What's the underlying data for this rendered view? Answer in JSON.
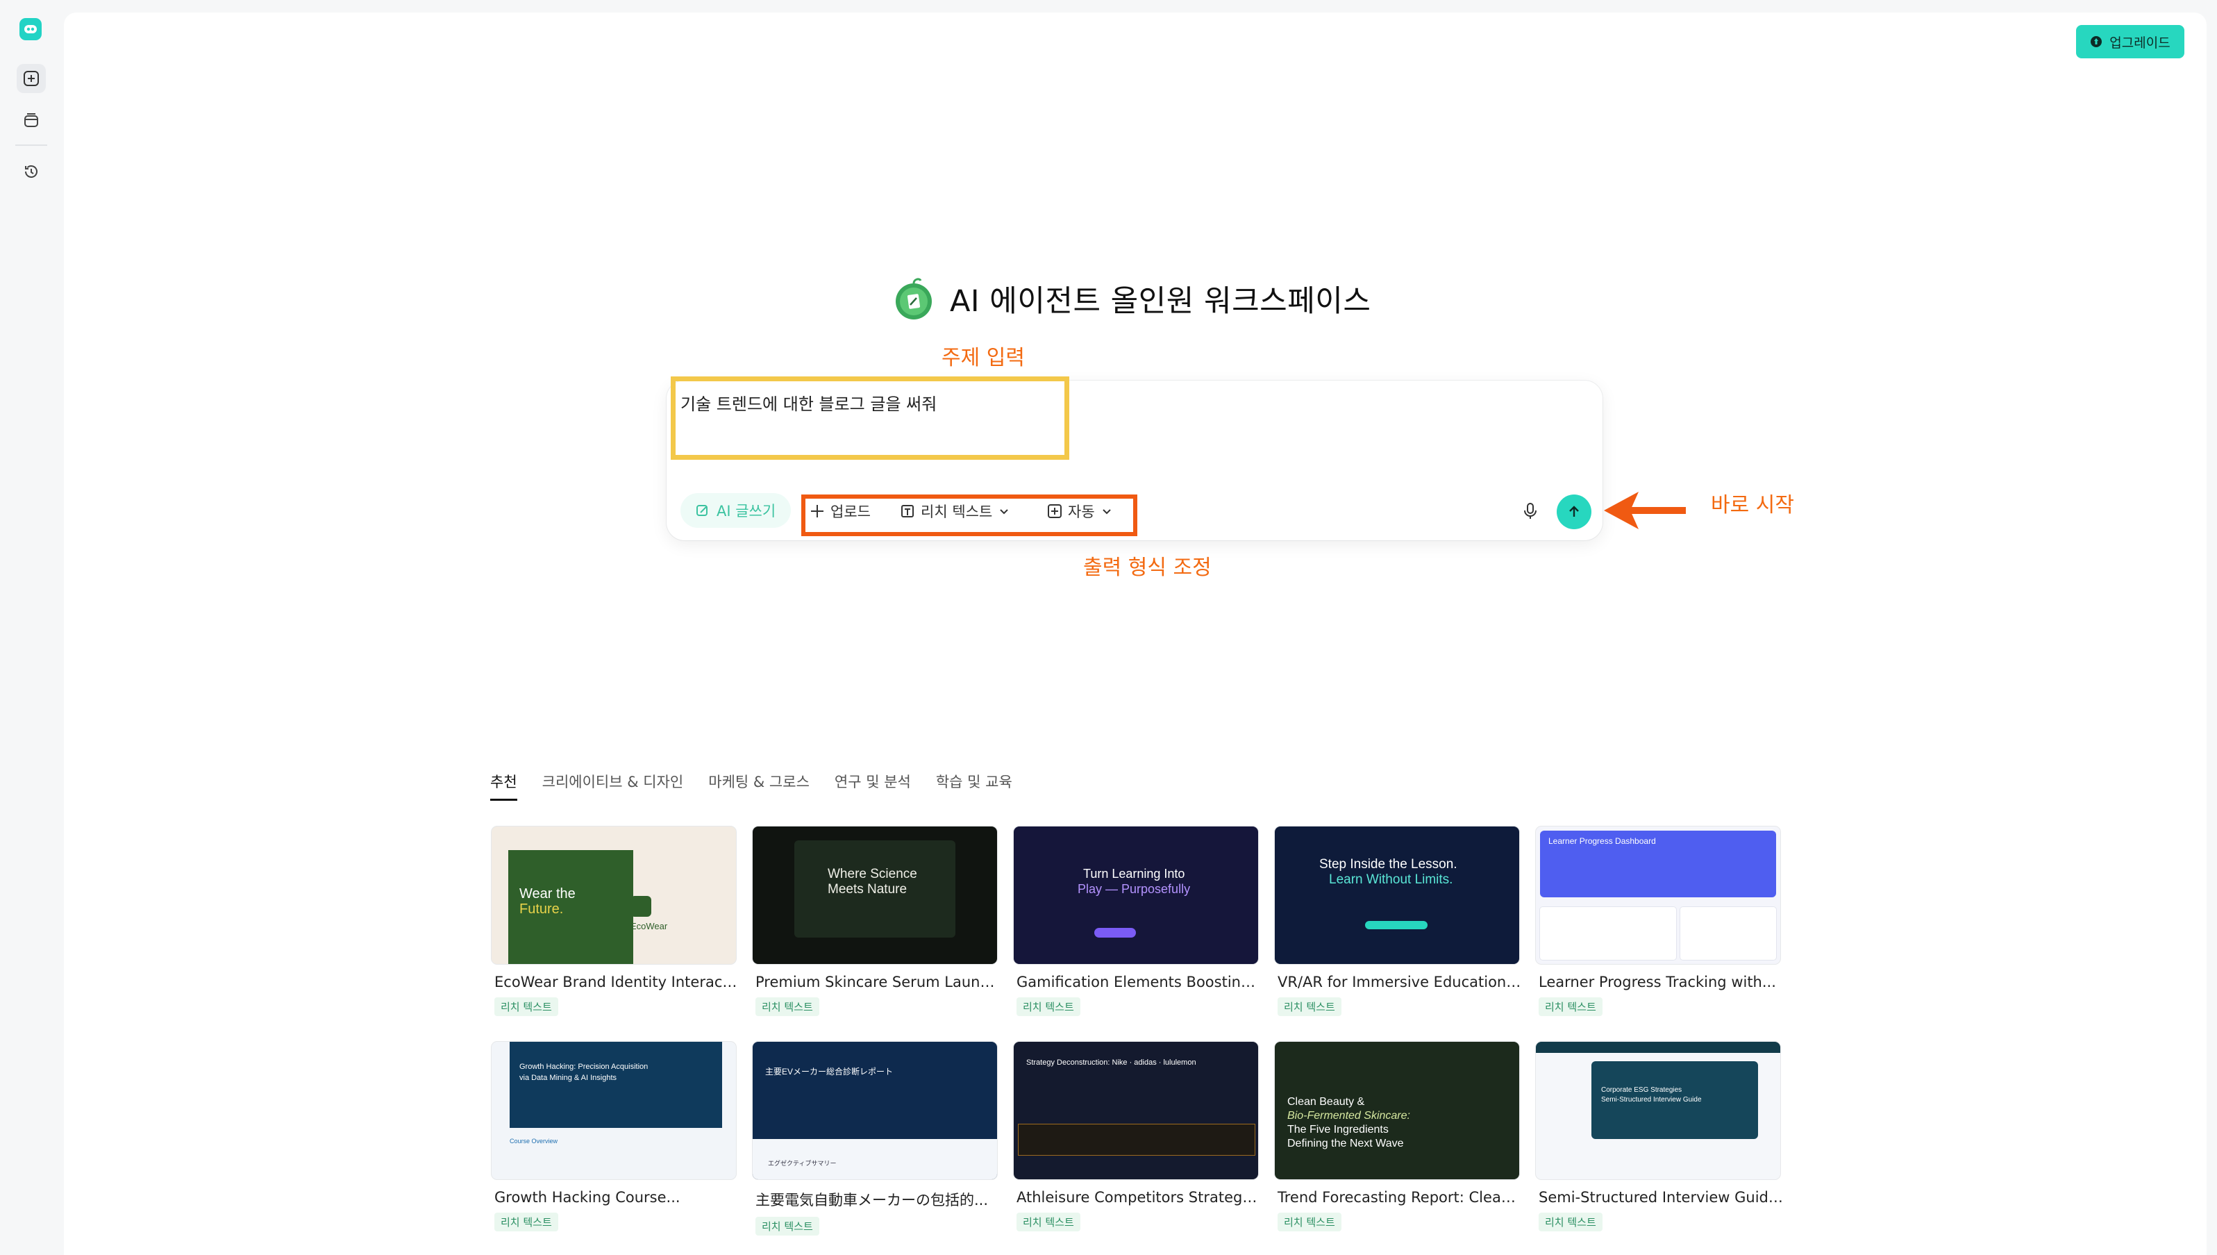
{
  "app": {
    "upgrade_label": "업그레이드",
    "accent_color": "#27d7bf"
  },
  "sidebar": {
    "items": [
      {
        "icon": "new-chat-icon"
      },
      {
        "icon": "library-icon"
      },
      {
        "icon": "history-icon"
      }
    ]
  },
  "hero": {
    "title": "AI 에이전트 올인원 워크스페이스"
  },
  "annotations": {
    "topic": "주제 입력",
    "format": "출력 형식 조정",
    "start": "바로 시작"
  },
  "composer": {
    "input_value": "기술 트렌드에 대한 블로그 글을 써줘",
    "ai_writing": "AI 글쓰기",
    "upload": "업로드",
    "rich_text": "리치 텍스트",
    "auto": "자동"
  },
  "tabs": [
    {
      "label": "추천",
      "active": true
    },
    {
      "label": "크리에이티브 & 디자인",
      "active": false
    },
    {
      "label": "마케팅 & 그로스",
      "active": false
    },
    {
      "label": "연구 및 분석",
      "active": false
    },
    {
      "label": "학습 및 교육",
      "active": false
    }
  ],
  "cards": [
    {
      "title": "EcoWear Brand Identity Interactiv...",
      "tag": "리치 텍스트",
      "thumb_text": [
        "Wear the",
        "Future.",
        "EcoWear"
      ]
    },
    {
      "title": "Premium Skincare Serum Launch...",
      "tag": "리치 텍스트",
      "thumb_text": [
        "Where Science",
        "Meets Nature"
      ]
    },
    {
      "title": "Gamification Elements Boosting...",
      "tag": "리치 텍스트",
      "thumb_text": [
        "Turn Learning Into",
        "Play — Purposefully"
      ]
    },
    {
      "title": "VR/AR for Immersive Educational...",
      "tag": "리치 텍스트",
      "thumb_text": [
        "Step Inside the Lesson.",
        "Learn Without Limits."
      ]
    },
    {
      "title": "Learner Progress Tracking with...",
      "tag": "리치 텍스트",
      "thumb_text": [
        "Learner Progress Dashboard"
      ]
    },
    {
      "title": "Growth Hacking Course...",
      "tag": "리치 텍스트",
      "thumb_text": [
        "Growth Hacking: Precision Acquisition",
        "via Data Mining & AI Insights",
        "Course Overview"
      ]
    },
    {
      "title": "主要電気自動車メーカーの包括的...",
      "tag": "리치 텍스트",
      "thumb_text": [
        "主要EVメーカー総合診断レポート",
        "エグゼクティブサマリー"
      ]
    },
    {
      "title": "Athleisure Competitors Strategy...",
      "tag": "리치 텍스트",
      "thumb_text": [
        "Strategy Deconstruction: Nike · adidas · lululemon"
      ]
    },
    {
      "title": "Trend Forecasting Report: Clean...",
      "tag": "리치 텍스트",
      "thumb_text": [
        "Clean Beauty &",
        "Bio-Fermented Skincare:",
        "The Five Ingredients",
        "Defining the Next Wave"
      ]
    },
    {
      "title": "Semi-Structured Interview Guide...",
      "tag": "리치 텍스트",
      "thumb_text": [
        "Corporate ESG Strategies",
        "Semi-Structured Interview Guide"
      ]
    }
  ]
}
